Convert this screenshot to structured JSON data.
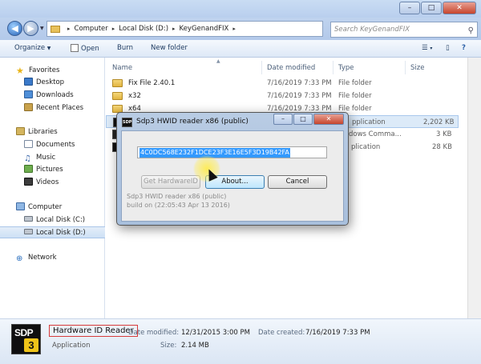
{
  "window": {
    "minimize_glyph": "–",
    "maximize_glyph": "□",
    "close_glyph": "✕",
    "back_glyph": "◀",
    "forward_glyph": "▶",
    "dropdown_glyph": "▼",
    "refresh_glyph": "⟳"
  },
  "address": {
    "segments": [
      "Computer",
      "Local Disk (D:)",
      "KeyGenandFIX"
    ],
    "separator": "▸",
    "dropdown_glyph": "▾"
  },
  "search": {
    "placeholder": "Search KeyGenandFIX",
    "icon": "⚲"
  },
  "toolbar": {
    "organize": "Organize",
    "organize_caret": "▼",
    "open": "Open",
    "burn": "Burn",
    "new_folder": "New folder",
    "view_glyph": "☰",
    "view_caret": "▾",
    "pane_glyph": "▯",
    "help_glyph": "?"
  },
  "sidebar": {
    "favorites": "Favorites",
    "favorites_items": [
      "Desktop",
      "Downloads",
      "Recent Places"
    ],
    "libraries": "Libraries",
    "libraries_items": [
      "Documents",
      "Music",
      "Pictures",
      "Videos"
    ],
    "computer": "Computer",
    "computer_items": [
      "Local Disk (C:)",
      "Local Disk (D:)"
    ],
    "network": "Network",
    "star_glyph": "★",
    "music_glyph": "♫",
    "network_glyph": "⊕"
  },
  "columns": {
    "name": "Name",
    "date": "Date modified",
    "type": "Type",
    "size": "Size",
    "sort_caret": "▲"
  },
  "files": [
    {
      "name": "Fix File 2.40.1",
      "date": "7/16/2019 7:33 PM",
      "type": "File folder",
      "size": ""
    },
    {
      "name": "x32",
      "date": "7/16/2019 7:33 PM",
      "type": "File folder",
      "size": ""
    },
    {
      "name": "x64",
      "date": "7/16/2019 7:33 PM",
      "type": "File folder",
      "size": ""
    },
    {
      "name": "",
      "date": "",
      "type": "pplication",
      "size": "2,202 KB"
    },
    {
      "name": "",
      "date": "",
      "type": "dows Comma...",
      "size": "3 KB"
    },
    {
      "name": "",
      "date": "",
      "type": "plication",
      "size": "28 KB"
    }
  ],
  "dialog": {
    "title": "Sdp3 HWID reader x86 (public)",
    "icon_text": "SDP",
    "hwid": "4C0DC568E232F1DCE23F3E16E5F3D19B42FA",
    "get_hwid": "Get HardwareID",
    "about": "About...",
    "cancel": "Cancel",
    "info_line1": "Sdp3 HWID reader x86 (public)",
    "info_line2": "build on (22:05:43 Apr 13 2016)",
    "minimize_glyph": "–",
    "maximize_glyph": "□",
    "close_glyph": "✕"
  },
  "details": {
    "logo_text": "SDP",
    "logo_num": "3",
    "name": "Hardware ID Reader",
    "type": "Application",
    "date_modified_label": "Date modified:",
    "date_modified": "12/31/2015 3:00 PM",
    "date_created_label": "Date created:",
    "date_created": "7/16/2019 7:33 PM",
    "size_label": "Size:",
    "size": "2.14 MB"
  },
  "colors": {
    "highlight": "#3399ff",
    "annotation": "#d63b3b",
    "glow": "#ffec50"
  }
}
